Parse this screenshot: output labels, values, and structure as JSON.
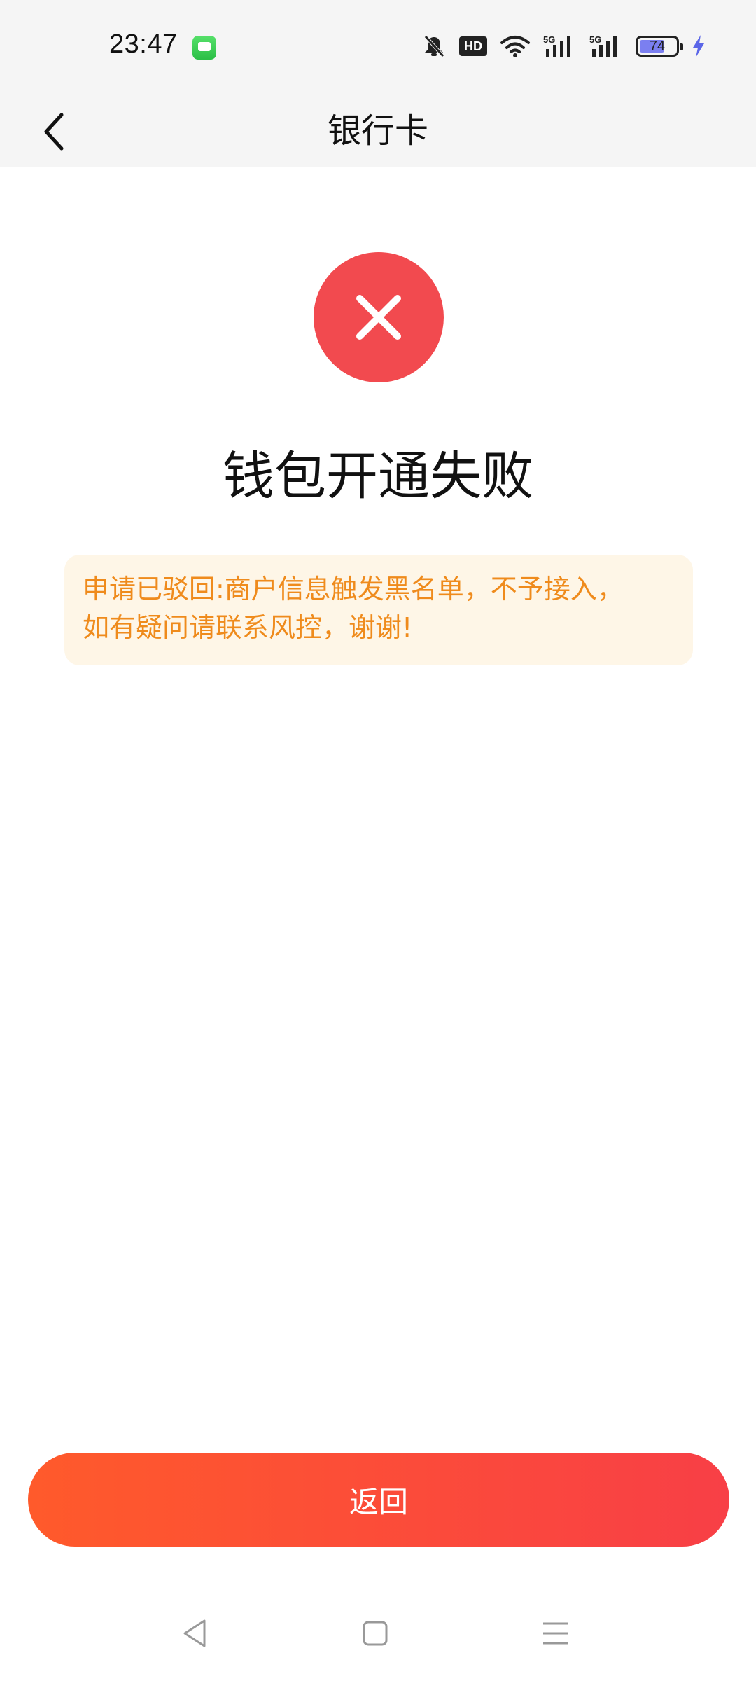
{
  "status_bar": {
    "time": "23:47",
    "hd_label": "HD",
    "battery_level": "74",
    "battery_fraction": 0.74,
    "icons": [
      "messages-app-icon",
      "mute-icon",
      "hd-icon",
      "wifi-icon",
      "signal-5g-icon",
      "signal-5g-icon",
      "battery-icon",
      "charging-icon"
    ]
  },
  "header": {
    "title": "银行卡",
    "back_icon": "chevron-left-icon"
  },
  "result": {
    "icon": "close-icon",
    "icon_color": "#f24a4f",
    "title": "钱包开通失败",
    "reason_lines": [
      "申请已驳回:商户信息触发黑名单，不予接入，",
      "如有疑问请联系风控，谢谢!"
    ],
    "reason_color": "#ef8b1c",
    "reason_bg": "#fef6e7"
  },
  "actions": {
    "return_label": "返回",
    "button_gradient": [
      "#ff5a2b",
      "#f83f46"
    ]
  },
  "system_nav": {
    "icons": [
      "back-triangle-icon",
      "home-square-icon",
      "menu-lines-icon"
    ]
  }
}
